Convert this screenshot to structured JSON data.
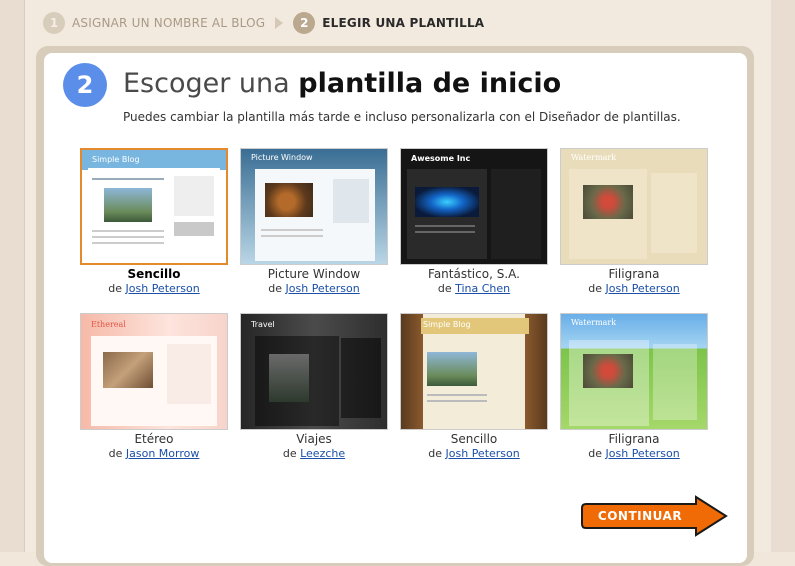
{
  "steps": [
    {
      "number": "1",
      "label": "ASIGNAR UN NOMBRE AL BLOG"
    },
    {
      "number": "2",
      "label": "ELEGIR UNA PLANTILLA"
    }
  ],
  "section": {
    "number": "2",
    "title_light": "Escoger una ",
    "title_bold": "plantilla de inicio",
    "subtitle": "Puedes cambiar la plantilla más tarde e incluso personalizarla con el Diseñador de plantillas."
  },
  "by_prefix": "de",
  "templates": [
    {
      "name": "Sencillo",
      "author": "Josh Peterson",
      "thumb_title": "Simple Blog",
      "selected": true
    },
    {
      "name": "Picture Window",
      "author": "Josh Peterson",
      "thumb_title": "Picture Window"
    },
    {
      "name": "Fantástico, S.A.",
      "author": "Tina Chen",
      "thumb_title": "Awesome Inc"
    },
    {
      "name": "Filigrana",
      "author": "Josh Peterson",
      "thumb_title": "Watermark"
    },
    {
      "name": "Etéreo",
      "author": "Jason Morrow",
      "thumb_title": "Ethereal"
    },
    {
      "name": "Viajes",
      "author": "Leezche",
      "thumb_title": "Travel"
    },
    {
      "name": "Sencillo",
      "author": "Josh Peterson",
      "thumb_title": "Simple Blog"
    },
    {
      "name": "Filigrana",
      "author": "Josh Peterson",
      "thumb_title": "Watermark"
    }
  ],
  "continue_label": "CONTINUAR",
  "colors": {
    "accent_blue": "#5b8ee8",
    "selected_border": "#e48a2c",
    "continue_orange": "#f06a06",
    "link": "#1b4fa8"
  }
}
